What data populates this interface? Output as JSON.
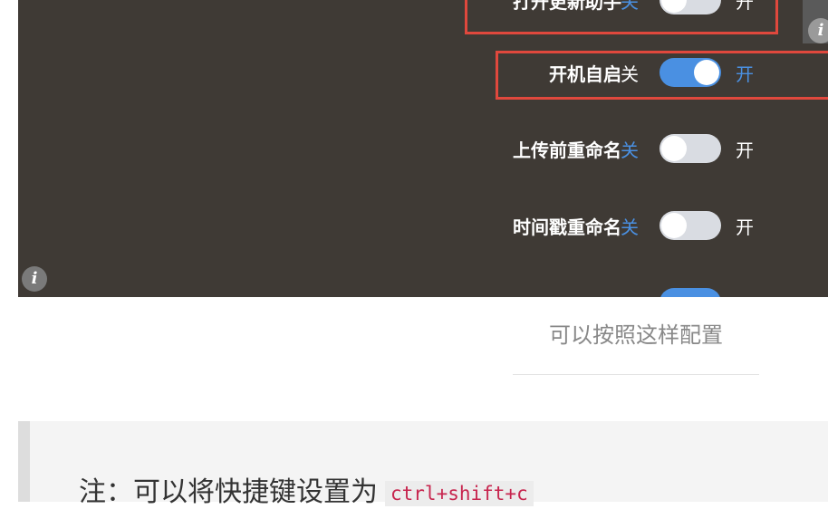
{
  "settings": {
    "off_label": "关",
    "on_label": "开",
    "rows": [
      {
        "label": "打开更新助手",
        "enabled": false
      },
      {
        "label": "开机自启",
        "enabled": true
      },
      {
        "label": "上传前重命名",
        "enabled": false
      },
      {
        "label": "时间戳重命名",
        "enabled": false
      }
    ]
  },
  "caption": "可以按照这样配置",
  "note": {
    "text": "注：可以将快捷键设置为",
    "shortcut": "ctrl+shift+c"
  },
  "icons": {
    "info": "i"
  },
  "colors": {
    "panel_bg": "#3f3a35",
    "accent": "#4a90e2",
    "highlight_border": "#e0483d"
  }
}
